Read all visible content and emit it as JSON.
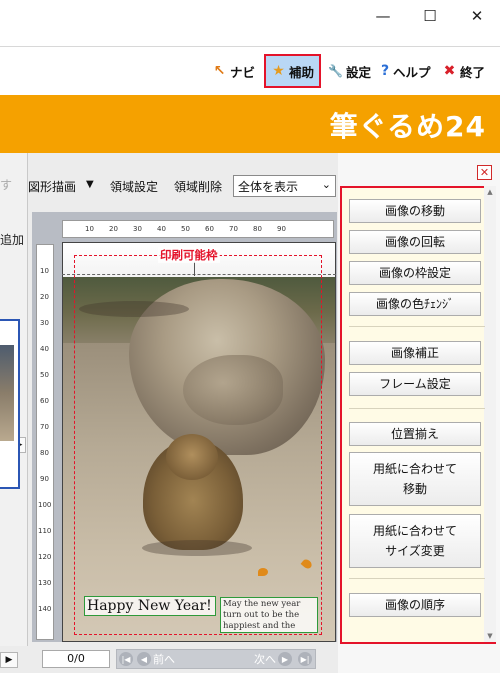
{
  "window_controls": {
    "minimize": "—",
    "maximize": "☐",
    "close": "✕"
  },
  "nav": {
    "items": [
      {
        "label": "ナビ",
        "icon": "pointer-arrow-icon",
        "icon_glyph": "↖",
        "color": "#e07a16"
      },
      {
        "label": "補助",
        "icon": "star-icon",
        "icon_glyph": "★",
        "color": "#e59b1e",
        "active": true
      },
      {
        "label": "設定",
        "icon": "wrench-icon",
        "icon_glyph": "🔧",
        "color": "#2e8a2e"
      },
      {
        "label": "ヘルプ",
        "icon": "question-icon",
        "icon_glyph": "?",
        "color": "#2b6fd6"
      },
      {
        "label": "終了",
        "icon": "close-x-icon",
        "icon_glyph": "✖",
        "color": "#d8202a"
      }
    ]
  },
  "brand": {
    "name": "筆ぐるめ24",
    "color": "#f5a100"
  },
  "left_panel": {
    "text_top": "す",
    "text_add": "追加"
  },
  "toolbar": {
    "shape_draw": "図形描画",
    "shape_dropdown": "▼",
    "area_set": "領域設定",
    "area_delete": "領域削除",
    "view_select": "全体を表示"
  },
  "ruler": {
    "h_ticks": [
      "10",
      "20",
      "30",
      "40",
      "50",
      "60",
      "70",
      "80",
      "90"
    ],
    "v_ticks": [
      "10",
      "20",
      "30",
      "40",
      "50",
      "60",
      "70",
      "80",
      "90",
      "100",
      "110",
      "120",
      "130",
      "140"
    ]
  },
  "canvas": {
    "print_area_label": "印刷可能枠",
    "greeting": "Happy New Year!",
    "message": "May the new year turn out to be the happiest and the best for you."
  },
  "pager": {
    "page": "0/0",
    "prev": "前へ",
    "next": "次へ"
  },
  "right_panel": {
    "close": "✕",
    "buttons": [
      "画像の移動",
      "画像の回転",
      "画像の枠設定",
      "画像の色ﾁｪﾝｼﾞ",
      "画像補正",
      "フレーム設定",
      "位置揃え",
      "用紙に合わせて\n移動",
      "用紙に合わせて\nサイズ変更",
      "画像の順序"
    ],
    "accent_color": "#e4132a",
    "bg_color": "#fffbe6"
  }
}
